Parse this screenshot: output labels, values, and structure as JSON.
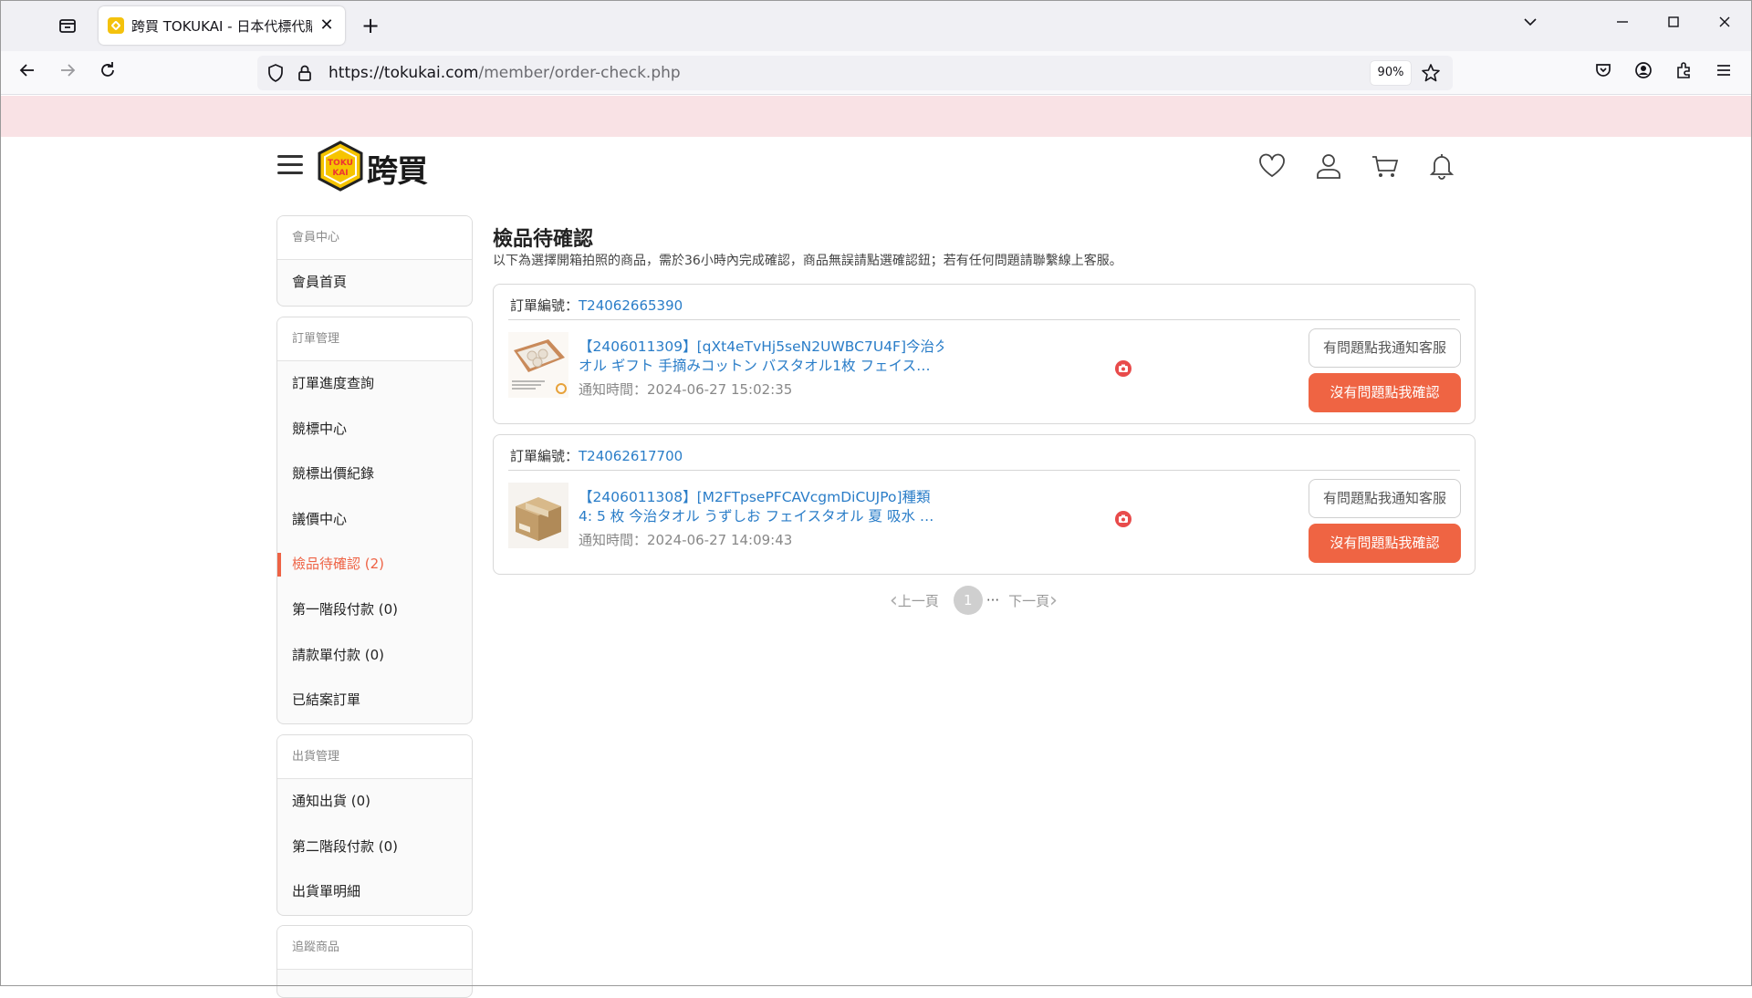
{
  "browser": {
    "tab_title": "跨買 TOKUKAI - 日本代標代購",
    "url_domain": "https://tokukai.com",
    "url_path": "/member/order-check.php",
    "zoom": "90%",
    "new_tab": "+",
    "close_tab": "✕"
  },
  "site": {
    "logo_badge_top": "TOKU",
    "logo_badge_bottom": "KAI",
    "logo_text": "跨買"
  },
  "sidebar": {
    "sections": [
      {
        "head": "會員中心",
        "items": [
          {
            "label": "會員首頁"
          }
        ]
      },
      {
        "head": "訂單管理",
        "items": [
          {
            "label": "訂單進度查詢"
          },
          {
            "label": "競標中心"
          },
          {
            "label": "競標出價紀錄"
          },
          {
            "label": "議價中心"
          },
          {
            "label": "檢品待確認 (2)",
            "active": true
          },
          {
            "label": "第一階段付款 (0)"
          },
          {
            "label": "請款單付款 (0)"
          },
          {
            "label": "已結案訂單"
          }
        ]
      },
      {
        "head": "出貨管理",
        "items": [
          {
            "label": "通知出貨 (0)"
          },
          {
            "label": "第二階段付款 (0)"
          },
          {
            "label": "出貨單明細"
          }
        ]
      },
      {
        "head": "追蹤商品",
        "items": []
      }
    ]
  },
  "main": {
    "title": "檢品待確認",
    "subtitle": "以下為選擇開箱拍照的商品，需於36小時內完成確認，商品無誤請點選確認鈕；若有任何問題請聯繫線上客服。",
    "order_label": "訂單編號：",
    "orders": [
      {
        "order_no": "T24062665390",
        "item_line1": "【2406011309】[qXt4eTvHj5seN2UWBC7U4F]今治タ",
        "item_line2": "オル ギフト 手摘みコットン バスタオル1枚 フェイス…",
        "notify_time": "通知時間：2024-06-27 15:02:35",
        "btn_issue": "有問題點我通知客服",
        "btn_ok": "沒有問題點我確認"
      },
      {
        "order_no": "T24062617700",
        "item_line1": "【2406011308】[M2FTpsePFCAVcgmDiCUJPo]種類",
        "item_line2": "4: 5 枚 今治タオル うずしお フェイスタオル 夏 吸水 …",
        "notify_time": "通知時間：2024-06-27 14:09:43",
        "btn_issue": "有問題點我通知客服",
        "btn_ok": "沒有問題點我確認"
      }
    ],
    "pager": {
      "prev": "上一頁",
      "current": "1",
      "ellipsis": "···",
      "next": "下一頁"
    }
  },
  "colors": {
    "accent": "#ef6443",
    "link": "#2a7dc8",
    "banner": "#f9e2e5"
  }
}
